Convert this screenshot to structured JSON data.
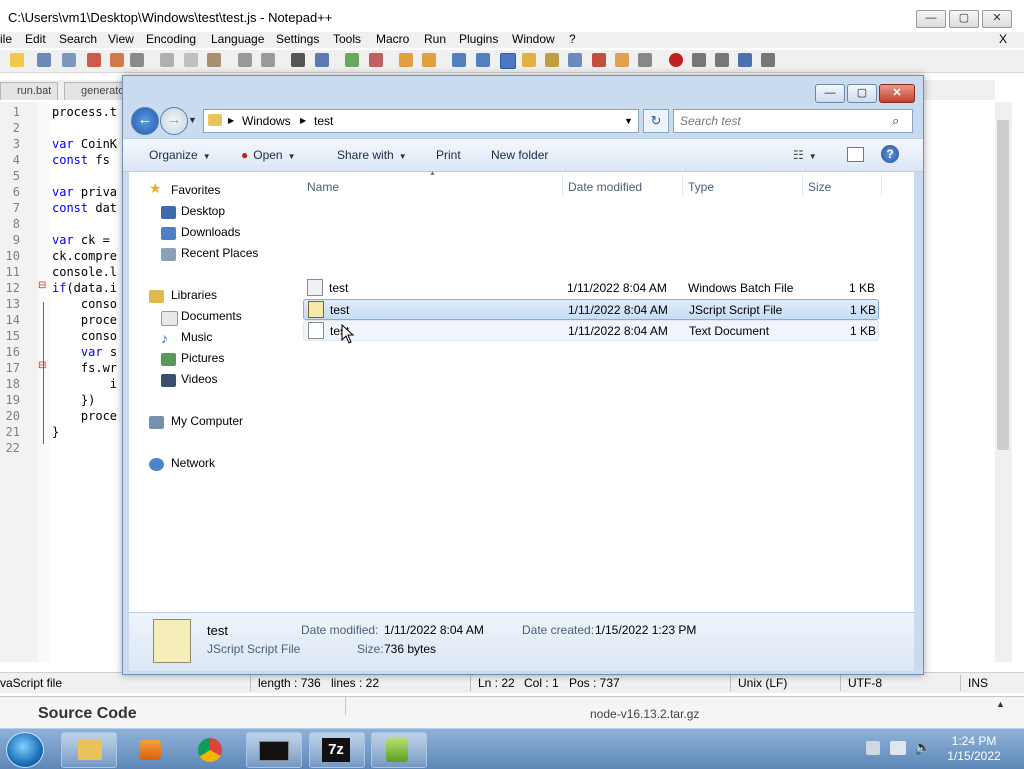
{
  "notepad": {
    "title": "C:\\Users\\vm1\\Desktop\\Windows\\test\\test.js - Notepad++",
    "window_controls": {
      "minimize": "—",
      "maximize": "▢",
      "close": "✕"
    },
    "menu_close": "X",
    "menu": [
      "ile",
      "Edit",
      "Search",
      "View",
      "Encoding",
      "Language",
      "Settings",
      "Tools",
      "Macro",
      "Run",
      "Plugins",
      "Window",
      "?"
    ],
    "tabs": [
      "run.bat",
      "generato"
    ],
    "line_numbers": [
      "1",
      "2",
      "3",
      "4",
      "5",
      "6",
      "7",
      "8",
      "9",
      "10",
      "11",
      "12",
      "13",
      "14",
      "15",
      "16",
      "17",
      "18",
      "19",
      "20",
      "21",
      "22"
    ],
    "code_lines": [
      "process.t",
      "",
      "var CoinK",
      "const fs ",
      "",
      "var priva",
      "const dat",
      "",
      "var ck = ",
      "ck.compre",
      "console.l",
      "if(data.i",
      "    conso",
      "    proce",
      "    conso",
      "    var s",
      "    fs.wr",
      "        i",
      "    })",
      "    proce",
      "}",
      ""
    ],
    "status": {
      "file_type": "vaScript file",
      "length": "length : 736",
      "lines": "lines : 22",
      "ln": "Ln : 22",
      "col": "Col : 1",
      "pos": "Pos : 737",
      "eol": "Unix (LF)",
      "encoding": "UTF-8",
      "mode": "INS"
    },
    "strip_left": "Source Code",
    "strip_right": "node-v16.13.2.tar.gz"
  },
  "explorer": {
    "window_controls": {
      "minimize": "—",
      "maximize": "▢",
      "close": "✕"
    },
    "breadcrumb": [
      "Windows",
      "test"
    ],
    "search_placeholder": "Search test",
    "commands": {
      "organize": "Organize",
      "open": "Open",
      "share": "Share with",
      "print": "Print",
      "new_folder": "New folder"
    },
    "nav": {
      "favorites": "Favorites",
      "favorites_items": [
        "Desktop",
        "Downloads",
        "Recent Places"
      ],
      "libraries": "Libraries",
      "libraries_items": [
        "Documents",
        "Music",
        "Pictures",
        "Videos"
      ],
      "computer": "My Computer",
      "network": "Network"
    },
    "columns": {
      "name": "Name",
      "date": "Date modified",
      "type": "Type",
      "size": "Size"
    },
    "files": [
      {
        "name": "test",
        "date": "1/11/2022 8:04 AM",
        "type": "Windows Batch File",
        "size": "1 KB"
      },
      {
        "name": "test",
        "date": "1/11/2022 8:04 AM",
        "type": "JScript Script File",
        "size": "1 KB"
      },
      {
        "name": "test",
        "date": "1/11/2022 8:04 AM",
        "type": "Text Document",
        "size": "1 KB"
      }
    ],
    "details": {
      "name": "test",
      "type": "JScript Script File",
      "modified_label": "Date modified:",
      "modified_value": "1/11/2022 8:04 AM",
      "created_label": "Date created:",
      "created_value": "1/15/2022 1:23 PM",
      "size_label": "Size:",
      "size_value": "736 bytes"
    }
  },
  "taskbar": {
    "apps": [
      "explorer",
      "media-player",
      "chrome",
      "cmd",
      "7-zip",
      "notepad++"
    ],
    "app_label_7z": "7z",
    "time": "1:24 PM",
    "date": "1/15/2022"
  },
  "colors": {
    "selection": "#c7dcf5",
    "keyword": "#0000ff",
    "taskbar": "#5d87b8"
  }
}
